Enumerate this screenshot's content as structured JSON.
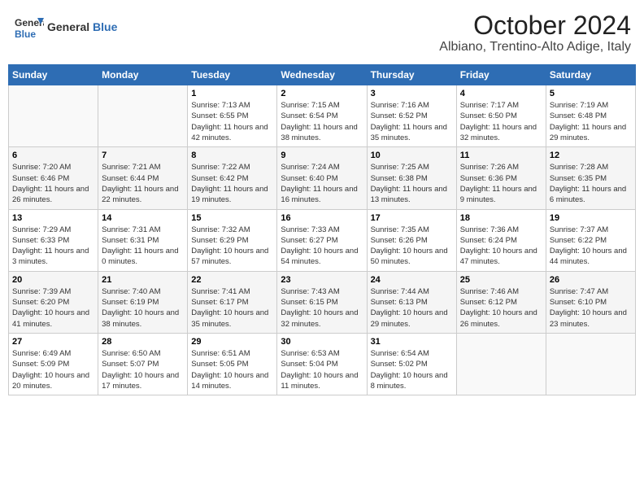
{
  "logo": {
    "text_general": "General",
    "text_blue": "Blue"
  },
  "title": "October 2024",
  "subtitle": "Albiano, Trentino-Alto Adige, Italy",
  "days_of_week": [
    "Sunday",
    "Monday",
    "Tuesday",
    "Wednesday",
    "Thursday",
    "Friday",
    "Saturday"
  ],
  "weeks": [
    [
      {
        "day": "",
        "sunrise": "",
        "sunset": "",
        "daylight": ""
      },
      {
        "day": "",
        "sunrise": "",
        "sunset": "",
        "daylight": ""
      },
      {
        "day": "1",
        "sunrise": "Sunrise: 7:13 AM",
        "sunset": "Sunset: 6:55 PM",
        "daylight": "Daylight: 11 hours and 42 minutes."
      },
      {
        "day": "2",
        "sunrise": "Sunrise: 7:15 AM",
        "sunset": "Sunset: 6:54 PM",
        "daylight": "Daylight: 11 hours and 38 minutes."
      },
      {
        "day": "3",
        "sunrise": "Sunrise: 7:16 AM",
        "sunset": "Sunset: 6:52 PM",
        "daylight": "Daylight: 11 hours and 35 minutes."
      },
      {
        "day": "4",
        "sunrise": "Sunrise: 7:17 AM",
        "sunset": "Sunset: 6:50 PM",
        "daylight": "Daylight: 11 hours and 32 minutes."
      },
      {
        "day": "5",
        "sunrise": "Sunrise: 7:19 AM",
        "sunset": "Sunset: 6:48 PM",
        "daylight": "Daylight: 11 hours and 29 minutes."
      }
    ],
    [
      {
        "day": "6",
        "sunrise": "Sunrise: 7:20 AM",
        "sunset": "Sunset: 6:46 PM",
        "daylight": "Daylight: 11 hours and 26 minutes."
      },
      {
        "day": "7",
        "sunrise": "Sunrise: 7:21 AM",
        "sunset": "Sunset: 6:44 PM",
        "daylight": "Daylight: 11 hours and 22 minutes."
      },
      {
        "day": "8",
        "sunrise": "Sunrise: 7:22 AM",
        "sunset": "Sunset: 6:42 PM",
        "daylight": "Daylight: 11 hours and 19 minutes."
      },
      {
        "day": "9",
        "sunrise": "Sunrise: 7:24 AM",
        "sunset": "Sunset: 6:40 PM",
        "daylight": "Daylight: 11 hours and 16 minutes."
      },
      {
        "day": "10",
        "sunrise": "Sunrise: 7:25 AM",
        "sunset": "Sunset: 6:38 PM",
        "daylight": "Daylight: 11 hours and 13 minutes."
      },
      {
        "day": "11",
        "sunrise": "Sunrise: 7:26 AM",
        "sunset": "Sunset: 6:36 PM",
        "daylight": "Daylight: 11 hours and 9 minutes."
      },
      {
        "day": "12",
        "sunrise": "Sunrise: 7:28 AM",
        "sunset": "Sunset: 6:35 PM",
        "daylight": "Daylight: 11 hours and 6 minutes."
      }
    ],
    [
      {
        "day": "13",
        "sunrise": "Sunrise: 7:29 AM",
        "sunset": "Sunset: 6:33 PM",
        "daylight": "Daylight: 11 hours and 3 minutes."
      },
      {
        "day": "14",
        "sunrise": "Sunrise: 7:31 AM",
        "sunset": "Sunset: 6:31 PM",
        "daylight": "Daylight: 11 hours and 0 minutes."
      },
      {
        "day": "15",
        "sunrise": "Sunrise: 7:32 AM",
        "sunset": "Sunset: 6:29 PM",
        "daylight": "Daylight: 10 hours and 57 minutes."
      },
      {
        "day": "16",
        "sunrise": "Sunrise: 7:33 AM",
        "sunset": "Sunset: 6:27 PM",
        "daylight": "Daylight: 10 hours and 54 minutes."
      },
      {
        "day": "17",
        "sunrise": "Sunrise: 7:35 AM",
        "sunset": "Sunset: 6:26 PM",
        "daylight": "Daylight: 10 hours and 50 minutes."
      },
      {
        "day": "18",
        "sunrise": "Sunrise: 7:36 AM",
        "sunset": "Sunset: 6:24 PM",
        "daylight": "Daylight: 10 hours and 47 minutes."
      },
      {
        "day": "19",
        "sunrise": "Sunrise: 7:37 AM",
        "sunset": "Sunset: 6:22 PM",
        "daylight": "Daylight: 10 hours and 44 minutes."
      }
    ],
    [
      {
        "day": "20",
        "sunrise": "Sunrise: 7:39 AM",
        "sunset": "Sunset: 6:20 PM",
        "daylight": "Daylight: 10 hours and 41 minutes."
      },
      {
        "day": "21",
        "sunrise": "Sunrise: 7:40 AM",
        "sunset": "Sunset: 6:19 PM",
        "daylight": "Daylight: 10 hours and 38 minutes."
      },
      {
        "day": "22",
        "sunrise": "Sunrise: 7:41 AM",
        "sunset": "Sunset: 6:17 PM",
        "daylight": "Daylight: 10 hours and 35 minutes."
      },
      {
        "day": "23",
        "sunrise": "Sunrise: 7:43 AM",
        "sunset": "Sunset: 6:15 PM",
        "daylight": "Daylight: 10 hours and 32 minutes."
      },
      {
        "day": "24",
        "sunrise": "Sunrise: 7:44 AM",
        "sunset": "Sunset: 6:13 PM",
        "daylight": "Daylight: 10 hours and 29 minutes."
      },
      {
        "day": "25",
        "sunrise": "Sunrise: 7:46 AM",
        "sunset": "Sunset: 6:12 PM",
        "daylight": "Daylight: 10 hours and 26 minutes."
      },
      {
        "day": "26",
        "sunrise": "Sunrise: 7:47 AM",
        "sunset": "Sunset: 6:10 PM",
        "daylight": "Daylight: 10 hours and 23 minutes."
      }
    ],
    [
      {
        "day": "27",
        "sunrise": "Sunrise: 6:49 AM",
        "sunset": "Sunset: 5:09 PM",
        "daylight": "Daylight: 10 hours and 20 minutes."
      },
      {
        "day": "28",
        "sunrise": "Sunrise: 6:50 AM",
        "sunset": "Sunset: 5:07 PM",
        "daylight": "Daylight: 10 hours and 17 minutes."
      },
      {
        "day": "29",
        "sunrise": "Sunrise: 6:51 AM",
        "sunset": "Sunset: 5:05 PM",
        "daylight": "Daylight: 10 hours and 14 minutes."
      },
      {
        "day": "30",
        "sunrise": "Sunrise: 6:53 AM",
        "sunset": "Sunset: 5:04 PM",
        "daylight": "Daylight: 10 hours and 11 minutes."
      },
      {
        "day": "31",
        "sunrise": "Sunrise: 6:54 AM",
        "sunset": "Sunset: 5:02 PM",
        "daylight": "Daylight: 10 hours and 8 minutes."
      },
      {
        "day": "",
        "sunrise": "",
        "sunset": "",
        "daylight": ""
      },
      {
        "day": "",
        "sunrise": "",
        "sunset": "",
        "daylight": ""
      }
    ]
  ]
}
